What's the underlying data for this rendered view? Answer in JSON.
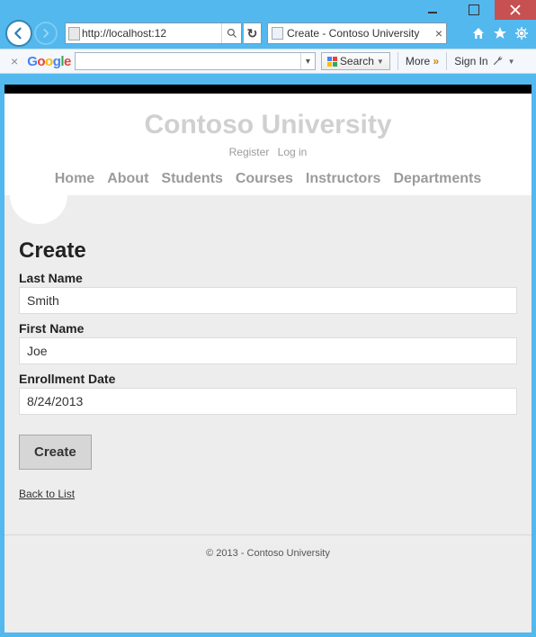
{
  "window": {
    "address_url": "http://localhost:12",
    "tab_title": "Create - Contoso University"
  },
  "google_toolbar": {
    "search_value": "",
    "search_label": "Search",
    "more_label": "More",
    "signin_label": "Sign In"
  },
  "site": {
    "title": "Contoso University",
    "account_links": [
      "Register",
      "Log in"
    ],
    "nav": [
      "Home",
      "About",
      "Students",
      "Courses",
      "Instructors",
      "Departments"
    ]
  },
  "page": {
    "heading": "Create",
    "fields": {
      "last_name": {
        "label": "Last Name",
        "value": "Smith"
      },
      "first_name": {
        "label": "First Name",
        "value": "Joe"
      },
      "enrollment_date": {
        "label": "Enrollment Date",
        "value": "8/24/2013"
      }
    },
    "submit_label": "Create",
    "back_link_label": "Back to List"
  },
  "footer": {
    "text": "© 2013 - Contoso University"
  }
}
